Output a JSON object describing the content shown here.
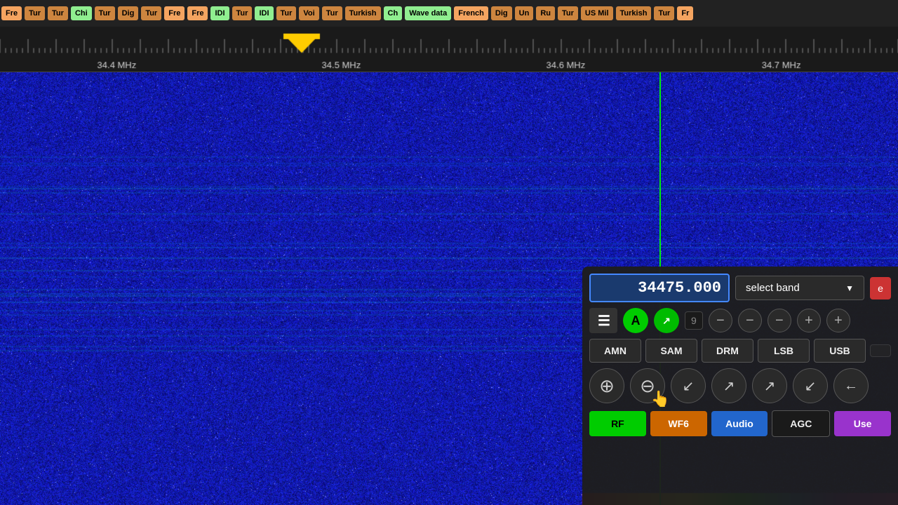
{
  "band_bar": {
    "items": [
      {
        "label": "Fre",
        "color": "#f4a460"
      },
      {
        "label": "Tur",
        "color": "#cd853f"
      },
      {
        "label": "Tur",
        "color": "#cd853f"
      },
      {
        "label": "Chi",
        "color": "#90ee90"
      },
      {
        "label": "Tur",
        "color": "#cd853f"
      },
      {
        "label": "Dig",
        "color": "#cd853f"
      },
      {
        "label": "Tur",
        "color": "#cd853f"
      },
      {
        "label": "Fre",
        "color": "#f4a460"
      },
      {
        "label": "Fre",
        "color": "#f4a460"
      },
      {
        "label": "IDI",
        "color": "#90ee90"
      },
      {
        "label": "Tur",
        "color": "#cd853f"
      },
      {
        "label": "IDI",
        "color": "#90ee90"
      },
      {
        "label": "Tur",
        "color": "#cd853f"
      },
      {
        "label": "Voi",
        "color": "#cd853f"
      },
      {
        "label": "Tur",
        "color": "#cd853f"
      },
      {
        "label": "Turkish",
        "color": "#cd853f"
      },
      {
        "label": "Ch",
        "color": "#90ee90"
      },
      {
        "label": "Wave data",
        "color": "#90ee90"
      },
      {
        "label": "French",
        "color": "#f4a460"
      },
      {
        "label": "Dig",
        "color": "#cd853f"
      },
      {
        "label": "Un",
        "color": "#cd853f"
      },
      {
        "label": "Ru",
        "color": "#cd853f"
      },
      {
        "label": "Tur",
        "color": "#cd853f"
      },
      {
        "label": "US Mil",
        "color": "#cd853f"
      },
      {
        "label": "Turkish",
        "color": "#cd853f"
      },
      {
        "label": "Tur",
        "color": "#cd853f"
      },
      {
        "label": "Fr",
        "color": "#f4a460"
      }
    ]
  },
  "ruler": {
    "freq_labels": [
      {
        "text": "34.4 MHz",
        "x_pct": 13
      },
      {
        "text": "34.5 MHz",
        "x_pct": 38
      },
      {
        "text": "34.6 MHz",
        "x_pct": 63
      },
      {
        "text": "34.7 MHz",
        "x_pct": 87
      }
    ]
  },
  "control": {
    "frequency": "34475.000",
    "select_band_label": "select band",
    "extra_label": "e",
    "menu_icon": "☰",
    "a_label": "A",
    "arrow_label": "↗",
    "num_value": "9",
    "minus_labels": [
      "−",
      "−",
      "−"
    ],
    "plus_labels": [
      "+",
      "+"
    ],
    "modes": [
      "AMN",
      "SAM",
      "DRM",
      "LSB",
      "USB"
    ],
    "zoom_plus_label": "⊕",
    "zoom_minus_label": "⊖",
    "shrink_label": "⤡",
    "expand_label": "⤢",
    "back_label": "←",
    "rf_label": "RF",
    "wf6_label": "WF6",
    "audio_label": "Audio",
    "agc_label": "AGC",
    "user_label": "Use"
  }
}
